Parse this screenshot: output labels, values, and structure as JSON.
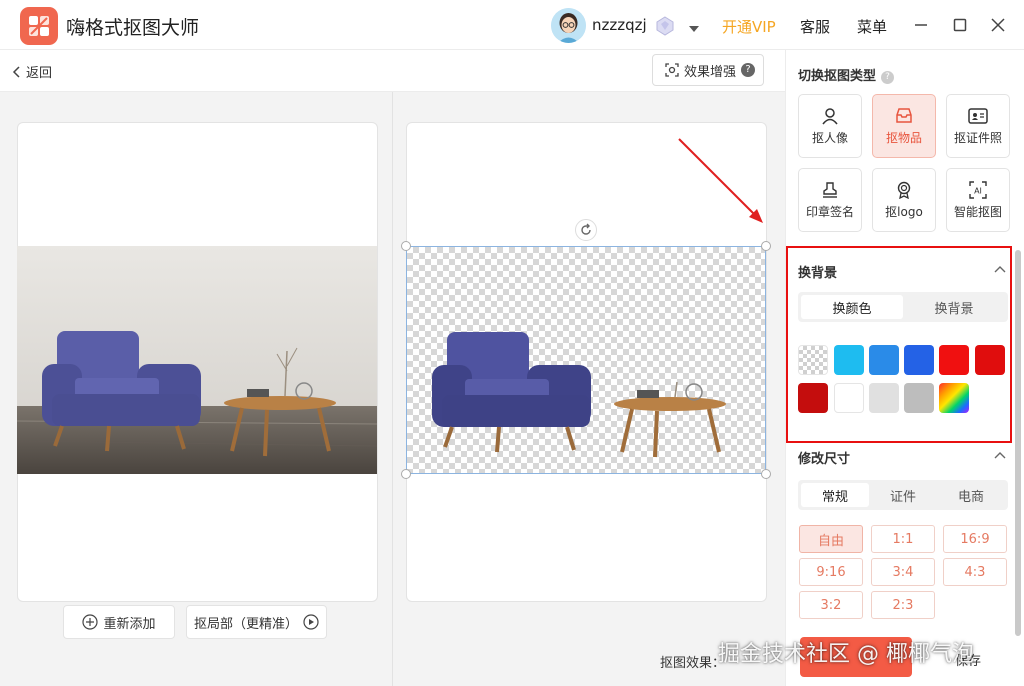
{
  "app": {
    "title": "嗨格式抠图大师"
  },
  "header": {
    "username": "nzzzqzj",
    "vip_label": "开通VIP",
    "service_label": "客服",
    "menu_label": "菜单"
  },
  "toolbar": {
    "back_label": "返回",
    "enhance_label": "效果增强",
    "enhance_badge": "?"
  },
  "canvas": {
    "readd_label": "重新添加",
    "local_cutout_label": "抠局部（更精准）",
    "effect_label": "抠图效果：",
    "save_label": "保存"
  },
  "sidebar": {
    "type_title": "切换抠图类型",
    "types": [
      {
        "label": "抠人像",
        "icon": "person-icon"
      },
      {
        "label": "抠物品",
        "icon": "box-icon"
      },
      {
        "label": "抠证件照",
        "icon": "id-card-icon"
      },
      {
        "label": "印章签名",
        "icon": "stamp-icon"
      },
      {
        "label": "抠logo",
        "icon": "medal-icon"
      },
      {
        "label": "智能抠图",
        "icon": "ai-icon"
      }
    ],
    "bg_section": {
      "title": "换背景",
      "tabs": [
        "换颜色",
        "换背景"
      ]
    },
    "swatches": [
      "transparent",
      "#1ebcf0",
      "#2a8be8",
      "#2462e6",
      "#f01010",
      "#e00d0d",
      "#c40d0d",
      "#ffffff",
      "#e0e0e0",
      "#bdbdbd",
      "gradient"
    ],
    "size_section": {
      "title": "修改尺寸",
      "tabs": [
        "常规",
        "证件",
        "电商"
      ],
      "options": [
        "自由",
        "1:1",
        "16:9",
        "9:16",
        "3:4",
        "4:3",
        "3:2",
        "2:3"
      ]
    }
  },
  "watermark": {
    "text": "掘金技术社区 @ 椰椰气泡"
  }
}
